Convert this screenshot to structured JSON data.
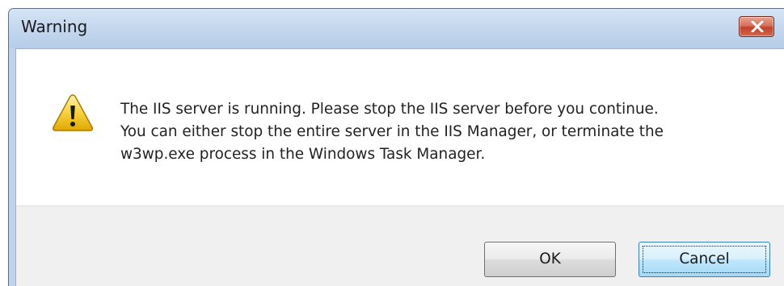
{
  "window": {
    "title": "Warning",
    "close_icon": "close-icon"
  },
  "content": {
    "icon": "warning-icon",
    "message": "The IIS server is running. Please stop the IIS server before you continue.\nYou can either stop the entire server in the IIS Manager, or terminate the\nw3wp.exe process in the Windows Task Manager."
  },
  "buttons": {
    "ok_label": "OK",
    "cancel_label": "Cancel"
  },
  "colors": {
    "titlebar": "#c5d8ee",
    "close_button": "#c2402c",
    "footer": "#f0f0f0",
    "focused_button": "#bee6fd"
  }
}
